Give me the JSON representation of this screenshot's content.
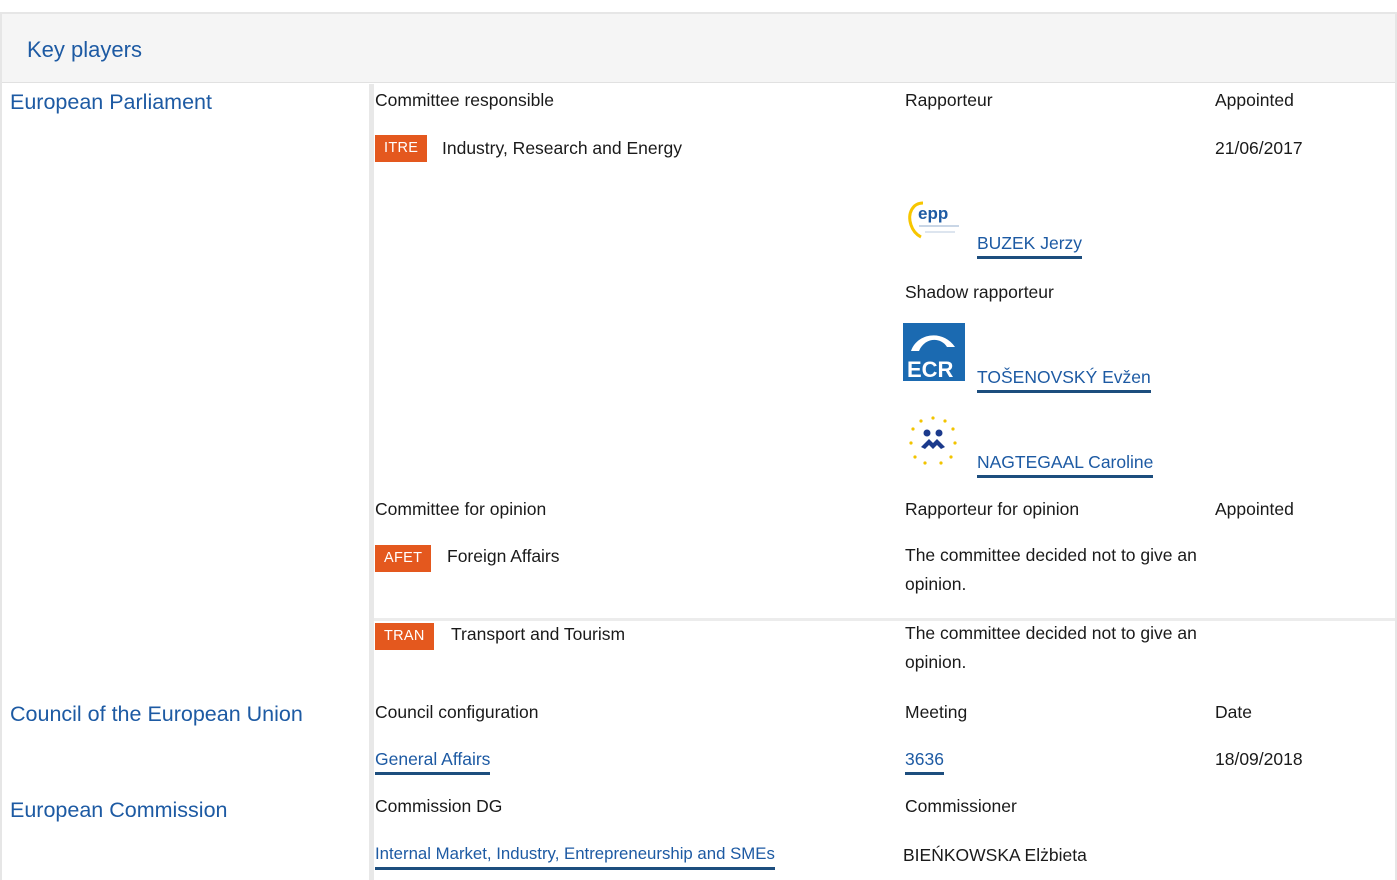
{
  "header": {
    "title": "Key players"
  },
  "parliament": {
    "label": "European Parliament",
    "committee_responsible": {
      "col_committee": "Committee responsible",
      "col_rapporteur": "Rapporteur",
      "col_appointed": "Appointed",
      "badge": "ITRE",
      "name": "Industry, Research and Energy",
      "appointed_date": "21/06/2017",
      "rapporteur": {
        "logo": "epp-logo",
        "logo_text": "epp",
        "name": "BUZEK Jerzy"
      },
      "shadow_label": "Shadow rapporteur",
      "shadows": [
        {
          "logo": "ecr-logo",
          "logo_text": "ECR",
          "name": "TOŠENOVSKÝ Evžen"
        },
        {
          "logo": "renew-logo",
          "name": "NAGTEGAAL Caroline"
        }
      ]
    },
    "committee_opinion": {
      "col_committee": "Committee for opinion",
      "col_rapporteur": "Rapporteur for opinion",
      "col_appointed": "Appointed",
      "rows": [
        {
          "badge": "AFET",
          "name": "Foreign Affairs",
          "note": "The committee decided not to give an opinion."
        },
        {
          "badge": "TRAN",
          "name": "Transport and Tourism",
          "note": "The committee decided not to give an opinion."
        }
      ]
    }
  },
  "council": {
    "label": "Council of the European Union",
    "col_config": "Council configuration",
    "col_meeting": "Meeting",
    "col_date": "Date",
    "configuration": "General Affairs",
    "meeting": "3636",
    "date": "18/09/2018"
  },
  "commission": {
    "label": "European Commission",
    "col_dg": "Commission DG",
    "col_commissioner": "Commissioner",
    "dg": "Internal Market, Industry, Entrepreneurship and SMEs",
    "commissioner": "BIEŃKOWSKA Elżbieta"
  },
  "colors": {
    "accent": "#1d5aa3",
    "badge": "#e4581e",
    "ecr": "#1b6ab1"
  }
}
